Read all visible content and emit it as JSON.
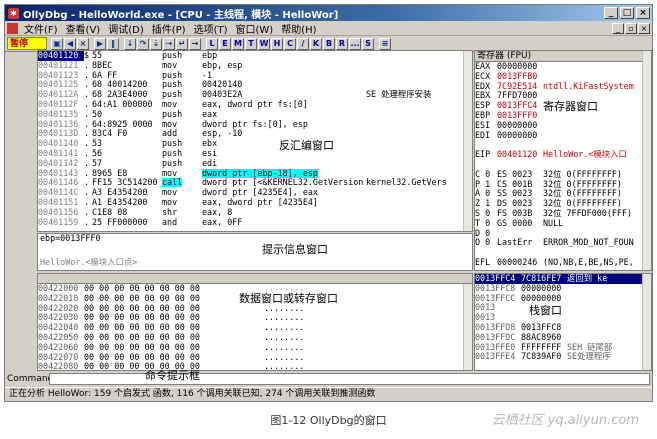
{
  "window": {
    "title": "OllyDbg - HelloWorld.exe - [CPU - 主线程, 模块 - HelloWor]",
    "app_icon": "bug-icon"
  },
  "menu": [
    "文件(F)",
    "查看(V)",
    "调试(D)",
    "插件(P)",
    "选项(T)",
    "窗口(W)",
    "帮助(H)"
  ],
  "toolbar": {
    "status": "暂停",
    "buttons": [
      "open-icon",
      "rewind-icon",
      "close-icon",
      "run-icon",
      "pause-icon",
      "step-into-icon",
      "step-over-icon",
      "trace-into-icon",
      "trace-over-icon",
      "execute-till-return-icon",
      "goto-icon",
      "menu-icon"
    ],
    "letters": [
      "L",
      "E",
      "M",
      "T",
      "W",
      "H",
      "C",
      "/",
      "K",
      "B",
      "R",
      "...",
      "S"
    ]
  },
  "disasm": {
    "rows": [
      {
        "addr": "00401120",
        "mk": "$",
        "hex": "55",
        "mnem": "push",
        "ops": "ebp",
        "cmt": "",
        "sel": true
      },
      {
        "addr": "00401121",
        "mk": ".",
        "hex": "8BEC",
        "mnem": "mov",
        "ops": "ebp, esp",
        "cmt": ""
      },
      {
        "addr": "00401123",
        "mk": ".",
        "hex": "6A FF",
        "mnem": "push",
        "ops": "-1",
        "cmt": ""
      },
      {
        "addr": "00401125",
        "mk": ".",
        "hex": "68 40014200",
        "mnem": "push",
        "ops": "00420140",
        "cmt": ""
      },
      {
        "addr": "0040112A",
        "mk": ".",
        "hex": "68 2A3E4000",
        "mnem": "push",
        "ops": "00403E2A",
        "cmt": "SE 处理程序安装"
      },
      {
        "addr": "0040112F",
        "mk": ".",
        "hex": "64:A1 000000",
        "mnem": "mov",
        "ops": "eax, dword ptr fs:[0]",
        "cmt": ""
      },
      {
        "addr": "00401135",
        "mk": ".",
        "hex": "50",
        "mnem": "push",
        "ops": "eax",
        "cmt": ""
      },
      {
        "addr": "00401136",
        "mk": ".",
        "hex": "64:8925 0000",
        "mnem": "mov",
        "ops": "dword ptr fs:[0], esp",
        "cmt": ""
      },
      {
        "addr": "0040113D",
        "mk": ".",
        "hex": "83C4 F0",
        "mnem": "add",
        "ops": "esp, -10",
        "cmt": ""
      },
      {
        "addr": "00401140",
        "mk": ".",
        "hex": "53",
        "mnem": "push",
        "ops": "ebx",
        "cmt": ""
      },
      {
        "addr": "00401141",
        "mk": ".",
        "hex": "56",
        "mnem": "push",
        "ops": "esi",
        "cmt": ""
      },
      {
        "addr": "00401142",
        "mk": ".",
        "hex": "57",
        "mnem": "push",
        "ops": "edi",
        "cmt": ""
      },
      {
        "addr": "00401143",
        "mk": ".",
        "hex": "8965 E8",
        "mnem": "mov",
        "ops": "dword ptr [ebp-18], esp",
        "cmt": "",
        "hl_ops": true
      },
      {
        "addr": "00401146",
        "mk": ".",
        "hex": "FF15 3C514200",
        "mnem": "call",
        "ops": "dword ptr [<&KERNEL32.GetVersion",
        "cmt": "kernel32.GetVers",
        "hl_mnem": true
      },
      {
        "addr": "0040114C",
        "mk": ".",
        "hex": "A3 E4354200",
        "mnem": "mov",
        "ops": "dword ptr [4235E4], eax",
        "cmt": ""
      },
      {
        "addr": "00401151",
        "mk": ".",
        "hex": "A1 E4354200",
        "mnem": "mov",
        "ops": "eax, dword ptr [4235E4]",
        "cmt": ""
      },
      {
        "addr": "00401156",
        "mk": ".",
        "hex": "C1E8 08",
        "mnem": "shr",
        "ops": "eax, 8",
        "cmt": ""
      },
      {
        "addr": "00401159",
        "mk": ".",
        "hex": "25 FF000000",
        "mnem": "and",
        "ops": "eax, 0FF",
        "cmt": ""
      }
    ]
  },
  "registers": {
    "title": "寄存器 (FPU)",
    "rows": [
      {
        "name": "EAX",
        "val": "00000000",
        "extra": "",
        "red": false
      },
      {
        "name": "ECX",
        "val": "0013FFB0",
        "extra": "",
        "red": true
      },
      {
        "name": "EDX",
        "val": "7C92E514",
        "extra": "ntdll.KiFastSystem",
        "red": true
      },
      {
        "name": "EBX",
        "val": "7FFD7000",
        "extra": "",
        "red": false
      },
      {
        "name": "ESP",
        "val": "0013FFC4",
        "extra": "",
        "red": true
      },
      {
        "name": "EBP",
        "val": "0013FFF0",
        "extra": "",
        "red": true
      },
      {
        "name": "ESI",
        "val": "00000000",
        "extra": "",
        "red": false
      },
      {
        "name": "EDI",
        "val": "00000000",
        "extra": "",
        "red": false
      },
      {
        "name": "",
        "val": "",
        "extra": "",
        "red": false
      },
      {
        "name": "EIP",
        "val": "00401120",
        "extra": "HelloWor.<模块入口",
        "red": true
      },
      {
        "name": "",
        "val": "",
        "extra": "",
        "red": false
      },
      {
        "name": "C 0",
        "val": "ES 0023",
        "extra": "32位 0(FFFFFFFF)",
        "red": false
      },
      {
        "name": "P 1",
        "val": "CS 001B",
        "extra": "32位 0(FFFFFFFF)",
        "red": false
      },
      {
        "name": "A 0",
        "val": "SS 0023",
        "extra": "32位 0(FFFFFFFF)",
        "red": false
      },
      {
        "name": "Z 1",
        "val": "DS 0023",
        "extra": "32位 0(FFFFFFFF)",
        "red": false
      },
      {
        "name": "S 0",
        "val": "FS 003B",
        "extra": "32位 7FFDF000(FFF)",
        "red": false
      },
      {
        "name": "T 0",
        "val": "GS 0000",
        "extra": "NULL",
        "red": false
      },
      {
        "name": "D 0",
        "val": "",
        "extra": "",
        "red": false
      },
      {
        "name": "O 0",
        "val": "LastErr",
        "extra": "ERROR_MOD_NOT_FOUN",
        "red": false
      },
      {
        "name": "",
        "val": "",
        "extra": "",
        "red": false
      },
      {
        "name": "EFL",
        "val": "00000246",
        "extra": "(NO,NB,E,BE,NS,PE,",
        "red": false
      }
    ]
  },
  "info": {
    "line1": "ebp=0013FFF0",
    "line2": "HelloWor.<模块入口点>"
  },
  "dump": {
    "rows": [
      {
        "a": "00422000",
        "h": "00 00 00 00 00 00 00 00",
        "s": "........"
      },
      {
        "a": "00422010",
        "h": "00 00 00 00 00 00 00 00",
        "s": "........"
      },
      {
        "a": "00422020",
        "h": "00 00 00 00 00 00 00 00",
        "s": "........"
      },
      {
        "a": "00422030",
        "h": "00 00 00 00 00 00 00 00",
        "s": "........"
      },
      {
        "a": "00422040",
        "h": "00 00 00 00 00 00 00 00",
        "s": "........"
      },
      {
        "a": "00422050",
        "h": "00 00 00 00 00 00 00 00",
        "s": "........"
      },
      {
        "a": "00422060",
        "h": "00 00 00 00 00 00 00 00",
        "s": "........"
      },
      {
        "a": "00422070",
        "h": "00 00 00 00 00 00 00 00",
        "s": "........"
      },
      {
        "a": "00422080",
        "h": "00 00 00 00 00 00 00 00",
        "s": "........"
      },
      {
        "a": "00422090",
        "h": "00 00 00 00 00 00 00 00",
        "s": "........"
      }
    ]
  },
  "stack": {
    "rows": [
      {
        "a": "0013FFC4",
        "v": "7C816FE7",
        "t": "返回到 ke",
        "sel": true
      },
      {
        "a": "0013FFC8",
        "v": "00000000",
        "t": ""
      },
      {
        "a": "0013FFCC",
        "v": "00000000",
        "t": ""
      },
      {
        "a": "0013",
        "v": "",
        "t": ""
      },
      {
        "a": "0013",
        "v": "",
        "t": ""
      },
      {
        "a": "0013FFD8",
        "v": "0013FFC8",
        "t": ""
      },
      {
        "a": "0013FFDC",
        "v": "88AC8960",
        "t": ""
      },
      {
        "a": "0013FFE0",
        "v": "FFFFFFFF",
        "t": "SEH 链尾部"
      },
      {
        "a": "0013FFE4",
        "v": "7C839AF0",
        "t": "SE处理程序"
      }
    ]
  },
  "command": {
    "label": "Command"
  },
  "statusbar": "正在分析 HelloWor: 159 个启发式 函数, 116 个调用关联已知, 274 个调用关联到推测函数",
  "notes": {
    "disasm": "反汇编窗口",
    "regs": "寄存器窗口",
    "info": "提示信息窗口",
    "dump": "数据窗口或转存窗口",
    "stack": "栈窗口",
    "cmd": "命令提示框"
  },
  "caption": "图1-12 OllyDbg的窗口",
  "watermark": "云栖社区 yq.aliyun.com",
  "colors": {
    "selected": "#000080",
    "highlight": "#00ffff",
    "paused": "#ffff00",
    "changed": "#d00000"
  }
}
